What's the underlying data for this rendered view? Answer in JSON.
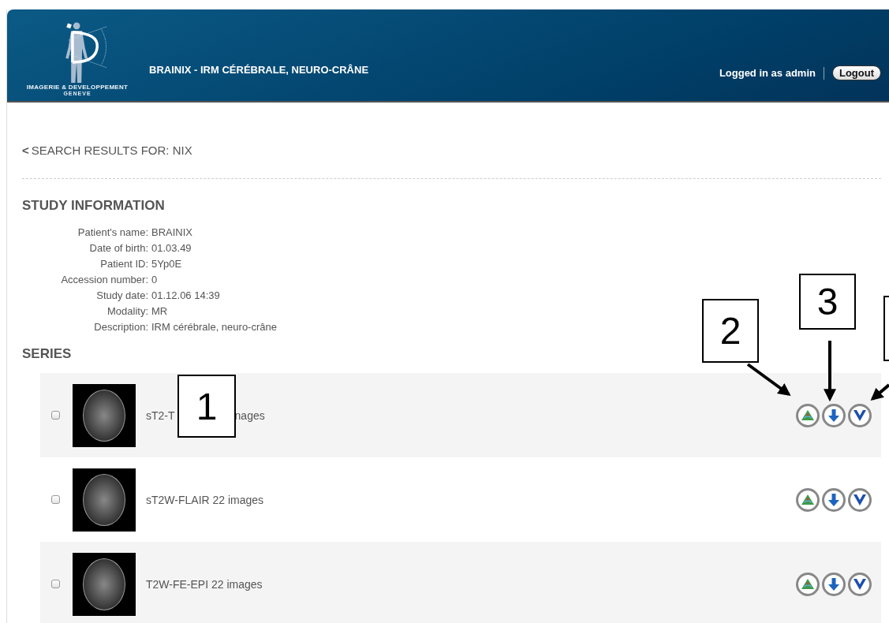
{
  "header": {
    "logo_lines": [
      "IMAGERIE & DEVELOPPEMENT",
      "GENEVE"
    ],
    "title": "BRAINIX - IRM CÉRÉBRALE, NEURO-CRÂNE",
    "user_text": "Logged in as admin",
    "logout": "Logout"
  },
  "back_link": {
    "icon": "<",
    "label": "SEARCH RESULTS FOR: NIX"
  },
  "study": {
    "heading": "STUDY INFORMATION",
    "fields": [
      {
        "label": "Patient's name:",
        "value": "BRAINIX"
      },
      {
        "label": "Date of birth:",
        "value": "01.03.49"
      },
      {
        "label": "Patient ID:",
        "value": "5Yp0E"
      },
      {
        "label": "Accession number:",
        "value": "0"
      },
      {
        "label": "Study date:",
        "value": "01.12.06 14:39"
      },
      {
        "label": "Modality:",
        "value": "MR"
      },
      {
        "label": "Description:",
        "value": "IRM cérébrale, neuro-crâne"
      }
    ]
  },
  "series": {
    "heading": "SERIES",
    "rows": [
      {
        "checked": false,
        "title_parts": [
          "sT2-T",
          "nages"
        ]
      },
      {
        "checked": false,
        "title_parts": [
          "sT2W-FLAIR 22 images"
        ]
      },
      {
        "checked": false,
        "title_parts": [
          "T2W-FE-EPI 22 images"
        ]
      }
    ]
  },
  "callouts": [
    {
      "label": "1"
    },
    {
      "label": "2"
    },
    {
      "label": "3"
    }
  ]
}
